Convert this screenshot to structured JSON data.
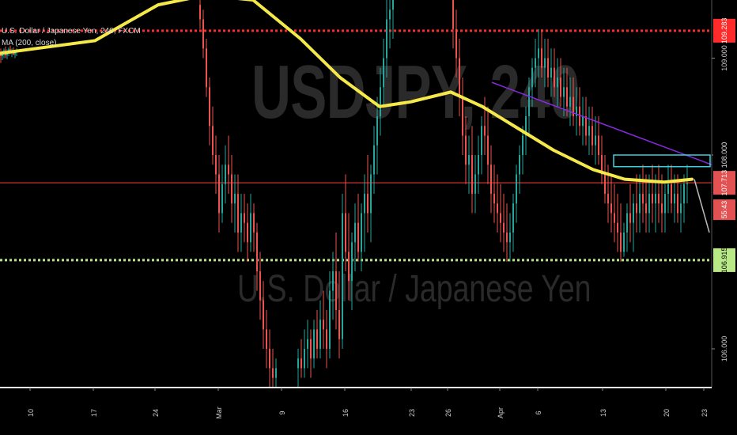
{
  "header": {
    "symbol_line": "U.S. Dollar / Japanese Yen, 240, FXCM",
    "indicator_line": "MA (200, close)"
  },
  "watermark": {
    "symbol": "USDJPY, 240",
    "description": "U.S. Dollar / Japanese Yen"
  },
  "chart_data": {
    "type": "candlestick",
    "title": "U.S. Dollar / Japanese Yen, 240, FXCM",
    "symbol": "USDJPY",
    "timeframe": "240",
    "source": "FXCM",
    "ylim": [
      105.6,
      109.6
    ],
    "y_ticks": [
      "109.000",
      "108.000",
      "106.000"
    ],
    "x_ticks": [
      "10",
      "17",
      "24",
      "Mar",
      "9",
      "16",
      "23",
      "26",
      "Apr",
      "6",
      "13",
      "20",
      "23"
    ],
    "price_labels": {
      "upper_red": "109.283",
      "last_price": "107.713",
      "countdown": "55:43",
      "cyan_line": "108.000",
      "green_line": "106.915"
    },
    "levels": [
      {
        "name": "resistance-dotted",
        "value": 109.283,
        "style": "dotted",
        "color": "#ff2a2a"
      },
      {
        "name": "last-price-line",
        "value": 107.713,
        "style": "solid",
        "color": "#c33"
      },
      {
        "name": "support-dotted",
        "value": 106.915,
        "style": "dotted",
        "color": "#b8e986"
      }
    ],
    "moving_average": {
      "name": "MA (200, close)",
      "color": "#f5e94a",
      "points": [
        [
          0,
          109.05
        ],
        [
          120,
          109.18
        ],
        [
          200,
          109.55
        ],
        [
          260,
          109.65
        ],
        [
          320,
          109.6
        ],
        [
          380,
          109.2
        ],
        [
          430,
          108.8
        ],
        [
          480,
          108.5
        ],
        [
          520,
          108.55
        ],
        [
          570,
          108.65
        ],
        [
          610,
          108.5
        ],
        [
          650,
          108.3
        ],
        [
          700,
          108.05
        ],
        [
          750,
          107.85
        ],
        [
          790,
          107.75
        ],
        [
          840,
          107.72
        ],
        [
          875,
          107.75
        ]
      ]
    },
    "trendlines": [
      {
        "name": "purple-trendline",
        "color": "#8a2be2",
        "from": [
          622,
          108.75
        ],
        "to": [
          900,
          107.9
        ]
      },
      {
        "name": "cyan-box",
        "color": "#3ad1e0",
        "x": [
          776,
          898
        ],
        "y": [
          107.88,
          108.0
        ]
      }
    ],
    "candles": [
      [
        0,
        109.05,
        109.1,
        108.95,
        109.02
      ],
      [
        2,
        109.02,
        109.08,
        108.98,
        109.05
      ],
      [
        4,
        109.05,
        109.1,
        109.0,
        109.08
      ],
      [
        6,
        109.08,
        109.12,
        109.0,
        109.03
      ],
      [
        8,
        109.03,
        109.09,
        108.99,
        109.06
      ],
      [
        10,
        109.06,
        109.11,
        109.02,
        109.09
      ],
      [
        12,
        109.09,
        109.13,
        109.04,
        109.05
      ],
      [
        14,
        109.05,
        109.1,
        109.01,
        109.07
      ],
      [
        16,
        109.07,
        109.11,
        109.03,
        109.04
      ],
      [
        18,
        109.04,
        109.08,
        109.0,
        109.06
      ],
      [
        20,
        109.06,
        109.1,
        109.02,
        109.08
      ],
      [
        252,
        109.55,
        109.7,
        109.3,
        109.4
      ],
      [
        256,
        109.4,
        109.5,
        109.0,
        109.1
      ],
      [
        260,
        109.1,
        109.2,
        108.6,
        108.7
      ],
      [
        264,
        108.7,
        108.8,
        108.1,
        108.3
      ],
      [
        268,
        108.3,
        108.5,
        107.9,
        108.0
      ],
      [
        272,
        108.0,
        108.2,
        107.6,
        107.8
      ],
      [
        276,
        107.8,
        108.0,
        107.2,
        107.4
      ],
      [
        280,
        107.4,
        107.9,
        107.3,
        107.7
      ],
      [
        284,
        107.7,
        108.1,
        107.5,
        107.9
      ],
      [
        288,
        107.9,
        108.2,
        107.6,
        107.8
      ],
      [
        292,
        107.8,
        108.0,
        107.3,
        107.5
      ],
      [
        296,
        107.5,
        107.8,
        107.2,
        107.6
      ],
      [
        300,
        107.6,
        107.8,
        107.0,
        107.2
      ],
      [
        304,
        107.2,
        107.6,
        107.0,
        107.4
      ],
      [
        308,
        107.4,
        107.6,
        107.1,
        107.3
      ],
      [
        312,
        107.3,
        107.5,
        106.9,
        107.1
      ],
      [
        316,
        107.1,
        107.6,
        107.0,
        107.4
      ],
      [
        320,
        107.4,
        107.5,
        107.0,
        107.2
      ],
      [
        324,
        107.2,
        107.3,
        106.6,
        106.8
      ],
      [
        328,
        106.8,
        107.0,
        106.3,
        106.5
      ],
      [
        332,
        106.5,
        106.7,
        106.0,
        106.2
      ],
      [
        336,
        106.2,
        106.4,
        105.8,
        106.0
      ],
      [
        340,
        106.0,
        106.2,
        105.6,
        105.8
      ],
      [
        344,
        105.8,
        106.0,
        105.6,
        105.7
      ],
      [
        348,
        105.7,
        105.9,
        105.6,
        105.8
      ],
      [
        376,
        105.8,
        106.0,
        105.6,
        105.9
      ],
      [
        380,
        105.9,
        106.1,
        105.7,
        105.8
      ],
      [
        384,
        105.8,
        106.2,
        105.7,
        106.0
      ],
      [
        388,
        106.0,
        106.3,
        105.8,
        106.1
      ],
      [
        392,
        106.1,
        106.2,
        105.7,
        105.9
      ],
      [
        396,
        105.9,
        106.3,
        105.8,
        106.2
      ],
      [
        400,
        106.2,
        106.4,
        105.9,
        106.0
      ],
      [
        404,
        106.0,
        106.5,
        105.9,
        106.3
      ],
      [
        408,
        106.3,
        106.6,
        106.0,
        106.2
      ],
      [
        412,
        106.2,
        106.4,
        105.8,
        106.0
      ],
      [
        416,
        106.0,
        106.8,
        105.9,
        106.6
      ],
      [
        420,
        106.6,
        107.0,
        106.3,
        106.8
      ],
      [
        424,
        106.8,
        107.2,
        106.2,
        106.4
      ],
      [
        428,
        106.4,
        106.8,
        105.9,
        106.1
      ],
      [
        432,
        106.1,
        107.6,
        106.0,
        107.4
      ],
      [
        436,
        107.4,
        107.8,
        106.8,
        107.0
      ],
      [
        440,
        107.0,
        107.4,
        106.5,
        106.7
      ],
      [
        444,
        106.7,
        107.2,
        106.4,
        107.1
      ],
      [
        448,
        107.1,
        107.5,
        106.8,
        107.3
      ],
      [
        452,
        107.3,
        107.6,
        106.9,
        107.0
      ],
      [
        456,
        107.0,
        107.5,
        106.8,
        107.4
      ],
      [
        460,
        107.4,
        107.8,
        107.0,
        107.6
      ],
      [
        464,
        107.6,
        108.0,
        107.2,
        107.4
      ],
      [
        468,
        107.4,
        107.9,
        107.1,
        107.8
      ],
      [
        472,
        107.8,
        108.3,
        107.6,
        108.1
      ],
      [
        476,
        108.1,
        108.6,
        107.8,
        108.4
      ],
      [
        480,
        108.4,
        108.9,
        108.2,
        108.7
      ],
      [
        484,
        108.7,
        109.2,
        108.5,
        109.0
      ],
      [
        488,
        109.0,
        109.6,
        108.8,
        109.4
      ],
      [
        492,
        109.4,
        109.7,
        109.1,
        109.5
      ],
      [
        496,
        109.5,
        109.7,
        109.2,
        109.6
      ],
      [
        572,
        109.6,
        109.7,
        109.1,
        109.3
      ],
      [
        576,
        109.3,
        109.5,
        108.8,
        109.0
      ],
      [
        580,
        109.0,
        109.2,
        108.4,
        108.6
      ],
      [
        584,
        108.6,
        108.8,
        108.0,
        108.2
      ],
      [
        588,
        108.2,
        108.4,
        107.7,
        107.9
      ],
      [
        592,
        107.9,
        108.2,
        107.6,
        108.0
      ],
      [
        596,
        108.0,
        108.3,
        107.4,
        107.6
      ],
      [
        600,
        107.6,
        108.0,
        107.4,
        107.8
      ],
      [
        604,
        107.8,
        108.2,
        107.6,
        108.0
      ],
      [
        608,
        108.0,
        108.4,
        107.8,
        108.3
      ],
      [
        612,
        108.3,
        108.6,
        108.0,
        108.2
      ],
      [
        616,
        108.2,
        108.5,
        107.7,
        107.9
      ],
      [
        620,
        107.9,
        108.1,
        107.4,
        107.6
      ],
      [
        624,
        107.6,
        107.9,
        107.3,
        107.5
      ],
      [
        628,
        107.5,
        107.8,
        107.2,
        107.4
      ],
      [
        632,
        107.4,
        107.7,
        107.1,
        107.3
      ],
      [
        636,
        107.3,
        107.6,
        107.0,
        107.2
      ],
      [
        640,
        107.2,
        107.5,
        106.9,
        107.1
      ],
      [
        644,
        107.1,
        107.4,
        106.9,
        107.2
      ],
      [
        648,
        107.2,
        107.6,
        107.0,
        107.5
      ],
      [
        652,
        107.5,
        107.9,
        107.3,
        107.8
      ],
      [
        656,
        107.8,
        108.1,
        107.6,
        108.0
      ],
      [
        660,
        108.0,
        108.3,
        107.8,
        108.2
      ],
      [
        664,
        108.2,
        108.5,
        108.0,
        108.4
      ],
      [
        668,
        108.4,
        108.8,
        108.2,
        108.7
      ],
      [
        672,
        108.7,
        109.0,
        108.5,
        108.9
      ],
      [
        676,
        108.9,
        109.2,
        108.7,
        109.0
      ],
      [
        680,
        109.0,
        109.3,
        108.8,
        109.1
      ],
      [
        684,
        109.1,
        109.3,
        108.8,
        108.9
      ],
      [
        688,
        108.9,
        109.2,
        108.7,
        109.0
      ],
      [
        692,
        109.0,
        109.2,
        108.7,
        108.8
      ],
      [
        696,
        108.8,
        109.1,
        108.6,
        108.9
      ],
      [
        700,
        108.9,
        109.1,
        108.6,
        108.7
      ],
      [
        704,
        108.7,
        109.0,
        108.5,
        108.8
      ],
      [
        708,
        108.8,
        109.0,
        108.5,
        108.6
      ],
      [
        712,
        108.6,
        108.9,
        108.4,
        108.7
      ],
      [
        716,
        108.7,
        108.9,
        108.4,
        108.5
      ],
      [
        720,
        108.5,
        108.8,
        108.3,
        108.6
      ],
      [
        724,
        108.6,
        108.8,
        108.3,
        108.4
      ],
      [
        728,
        108.4,
        108.7,
        108.2,
        108.5
      ],
      [
        732,
        108.5,
        108.7,
        108.2,
        108.3
      ],
      [
        736,
        108.3,
        108.6,
        108.1,
        108.4
      ],
      [
        740,
        108.4,
        108.6,
        108.1,
        108.2
      ],
      [
        744,
        108.2,
        108.5,
        108.0,
        108.3
      ],
      [
        748,
        108.3,
        108.5,
        108.0,
        108.1
      ],
      [
        752,
        108.1,
        108.4,
        107.9,
        108.2
      ],
      [
        756,
        108.2,
        108.4,
        107.9,
        108.0
      ],
      [
        760,
        108.0,
        108.2,
        107.7,
        107.8
      ],
      [
        764,
        107.8,
        108.0,
        107.5,
        107.6
      ],
      [
        768,
        107.6,
        107.9,
        107.3,
        107.5
      ],
      [
        772,
        107.5,
        107.8,
        107.2,
        107.4
      ],
      [
        776,
        107.4,
        107.7,
        107.1,
        107.3
      ],
      [
        780,
        107.3,
        107.6,
        107.0,
        107.2
      ],
      [
        784,
        107.2,
        107.5,
        106.9,
        107.0
      ],
      [
        788,
        107.0,
        107.3,
        106.95,
        107.2
      ],
      [
        792,
        107.2,
        107.5,
        107.0,
        107.4
      ],
      [
        796,
        107.4,
        107.7,
        107.1,
        107.3
      ],
      [
        800,
        107.3,
        107.6,
        107.0,
        107.5
      ],
      [
        804,
        107.5,
        107.8,
        107.2,
        107.4
      ],
      [
        808,
        107.4,
        107.8,
        107.2,
        107.6
      ],
      [
        812,
        107.6,
        107.9,
        107.3,
        107.5
      ],
      [
        816,
        107.5,
        107.8,
        107.2,
        107.4
      ],
      [
        820,
        107.4,
        107.8,
        107.2,
        107.6
      ],
      [
        824,
        107.6,
        107.9,
        107.3,
        107.5
      ],
      [
        828,
        107.5,
        107.8,
        107.2,
        107.6
      ],
      [
        832,
        107.6,
        107.9,
        107.3,
        107.5
      ],
      [
        836,
        107.5,
        107.8,
        107.2,
        107.4
      ],
      [
        840,
        107.4,
        107.7,
        107.2,
        107.6
      ],
      [
        844,
        107.6,
        107.9,
        107.4,
        107.7
      ],
      [
        848,
        107.7,
        107.9,
        107.4,
        107.5
      ],
      [
        852,
        107.5,
        107.8,
        107.3,
        107.6
      ],
      [
        856,
        107.6,
        107.8,
        107.3,
        107.4
      ],
      [
        860,
        107.4,
        107.7,
        107.2,
        107.5
      ],
      [
        864,
        107.5,
        107.8,
        107.3,
        107.7
      ],
      [
        868,
        107.7,
        107.9,
        107.5,
        107.71
      ]
    ]
  }
}
